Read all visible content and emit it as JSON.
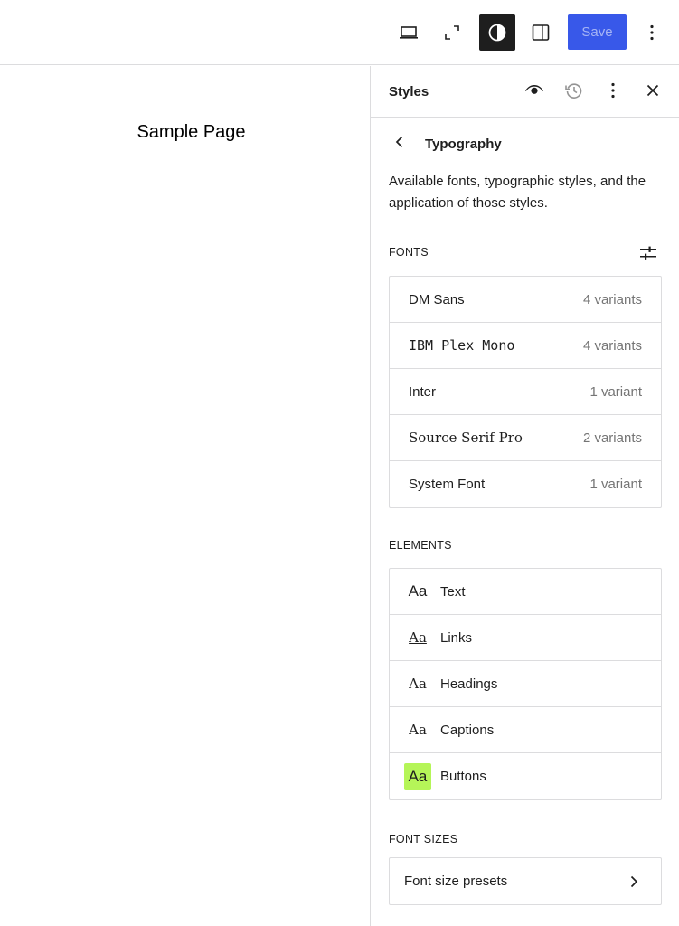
{
  "toolbar": {
    "save_label": "Save",
    "icons": [
      "laptop-icon",
      "fullscreen-icon",
      "styles-contrast-icon",
      "sidebar-toggle-icon",
      "more-options-icon"
    ]
  },
  "canvas": {
    "page_title": "Sample Page"
  },
  "sidebar": {
    "title": "Styles",
    "header_icons": [
      "eye-icon",
      "revisions-icon",
      "more-options-icon",
      "close-icon"
    ],
    "nav_title": "Typography",
    "description": "Available fonts, typographic styles, and the application of those styles.",
    "fonts_label": "Fonts",
    "fonts": [
      {
        "name": "DM Sans",
        "variants": "4 variants"
      },
      {
        "name": "IBM Plex Mono",
        "variants": "4 variants"
      },
      {
        "name": "Inter",
        "variants": "1 variant"
      },
      {
        "name": "Source Serif Pro",
        "variants": "2 variants"
      },
      {
        "name": "System Font",
        "variants": "1 variant"
      }
    ],
    "elements_label": "Elements",
    "elements": [
      {
        "preview": "Aa",
        "label": "Text"
      },
      {
        "preview": "Aa",
        "label": "Links"
      },
      {
        "preview": "Aa",
        "label": "Headings"
      },
      {
        "preview": "Aa",
        "label": "Captions"
      },
      {
        "preview": "Aa",
        "label": "Buttons"
      }
    ],
    "font_sizes_label": "Font Sizes",
    "font_size_presets_label": "Font size presets"
  },
  "colors": {
    "accent": "#3858e9",
    "button_preview_bg": "#b5f558",
    "active_toolbar_bg": "#1e1e1e"
  }
}
